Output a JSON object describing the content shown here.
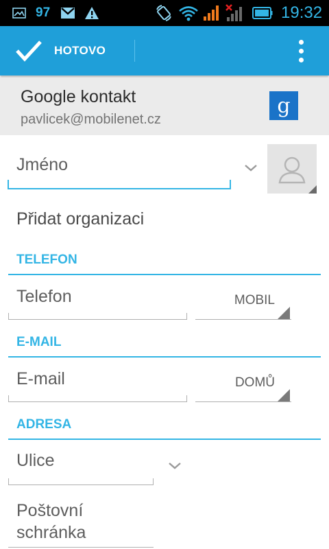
{
  "status_bar": {
    "battery_level": "97",
    "time": "19:32",
    "icons": [
      "image-icon",
      "gmail-icon",
      "warning-icon",
      "rotation-icon",
      "wifi-icon",
      "signal-icon",
      "no-signal-icon",
      "battery-icon"
    ]
  },
  "action_bar": {
    "done_label": "HOTOVO",
    "accent_color": "#1f9fd9"
  },
  "account": {
    "title": "Google kontakt",
    "email": "pavlicek@mobilenet.cz",
    "logo_letter": "g"
  },
  "form": {
    "name_placeholder": "Jméno",
    "add_organization": "Přidat organizaci",
    "sections": {
      "phone": "TELEFON",
      "email": "E-MAIL",
      "address": "ADRESA"
    },
    "phone_placeholder": "Telefon",
    "phone_type": "MOBIL",
    "email_placeholder": "E-mail",
    "email_type": "DOMŮ",
    "street_placeholder": "Ulice",
    "po_box_line1": "Poštovní",
    "po_box_line2": "schránka"
  }
}
